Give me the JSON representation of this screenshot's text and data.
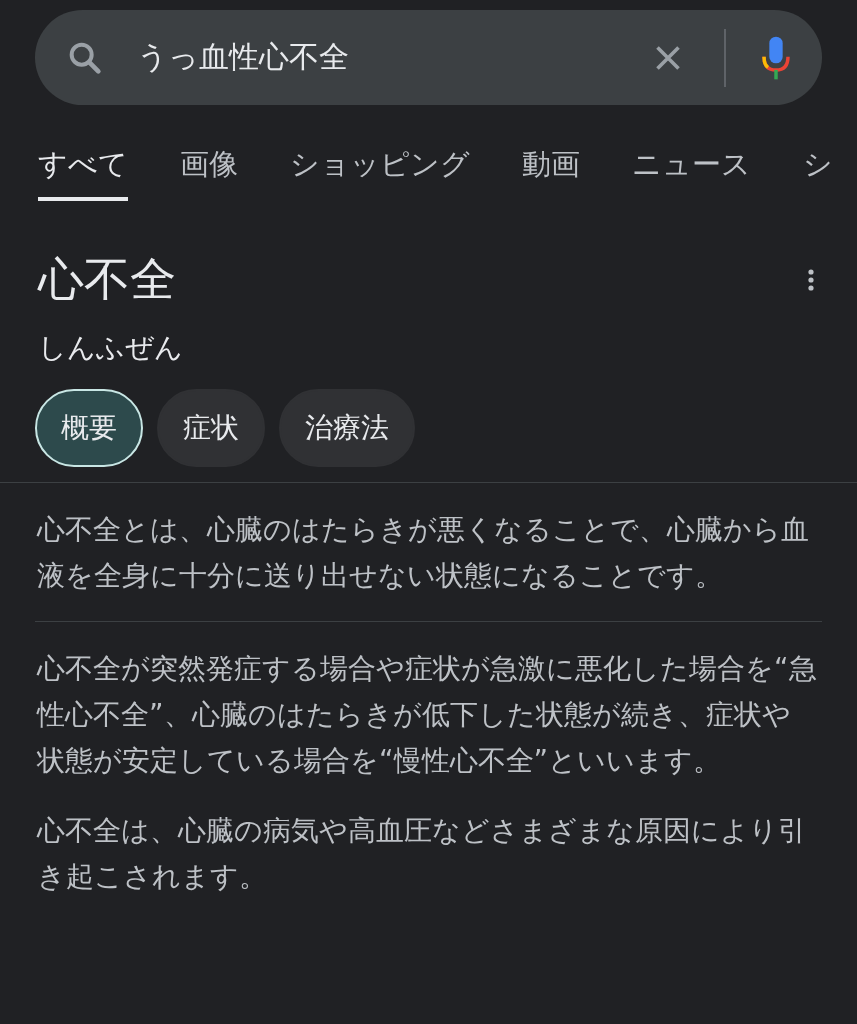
{
  "search": {
    "value": "うっ血性心不全"
  },
  "tabs": [
    {
      "label": "すべて",
      "selected": true
    },
    {
      "label": "画像",
      "selected": false
    },
    {
      "label": "ショッピング",
      "selected": false
    },
    {
      "label": "動画",
      "selected": false
    },
    {
      "label": "ニュース",
      "selected": false
    },
    {
      "label": "シ",
      "selected": false
    }
  ],
  "entity": {
    "title": "心不全",
    "reading": "しんふぜん"
  },
  "chips": [
    {
      "label": "概要",
      "selected": true
    },
    {
      "label": "症状",
      "selected": false
    },
    {
      "label": "治療法",
      "selected": false
    }
  ],
  "sections": [
    {
      "paragraphs": [
        "心不全とは、心臓のはたらきが悪くなることで、心臓から血液を全身に十分に送り出せない状態になることです。"
      ]
    },
    {
      "paragraphs": [
        "心不全が突然発症する場合や症状が急激に悪化した場合を“急性心不全”、心臓のはたらきが低下した状態が続き、症状や状態が安定している場合を“慢性心不全”といいます。",
        "心不全は、心臓の病気や高血圧などさまざまな原因により引き起こされます。"
      ]
    }
  ]
}
